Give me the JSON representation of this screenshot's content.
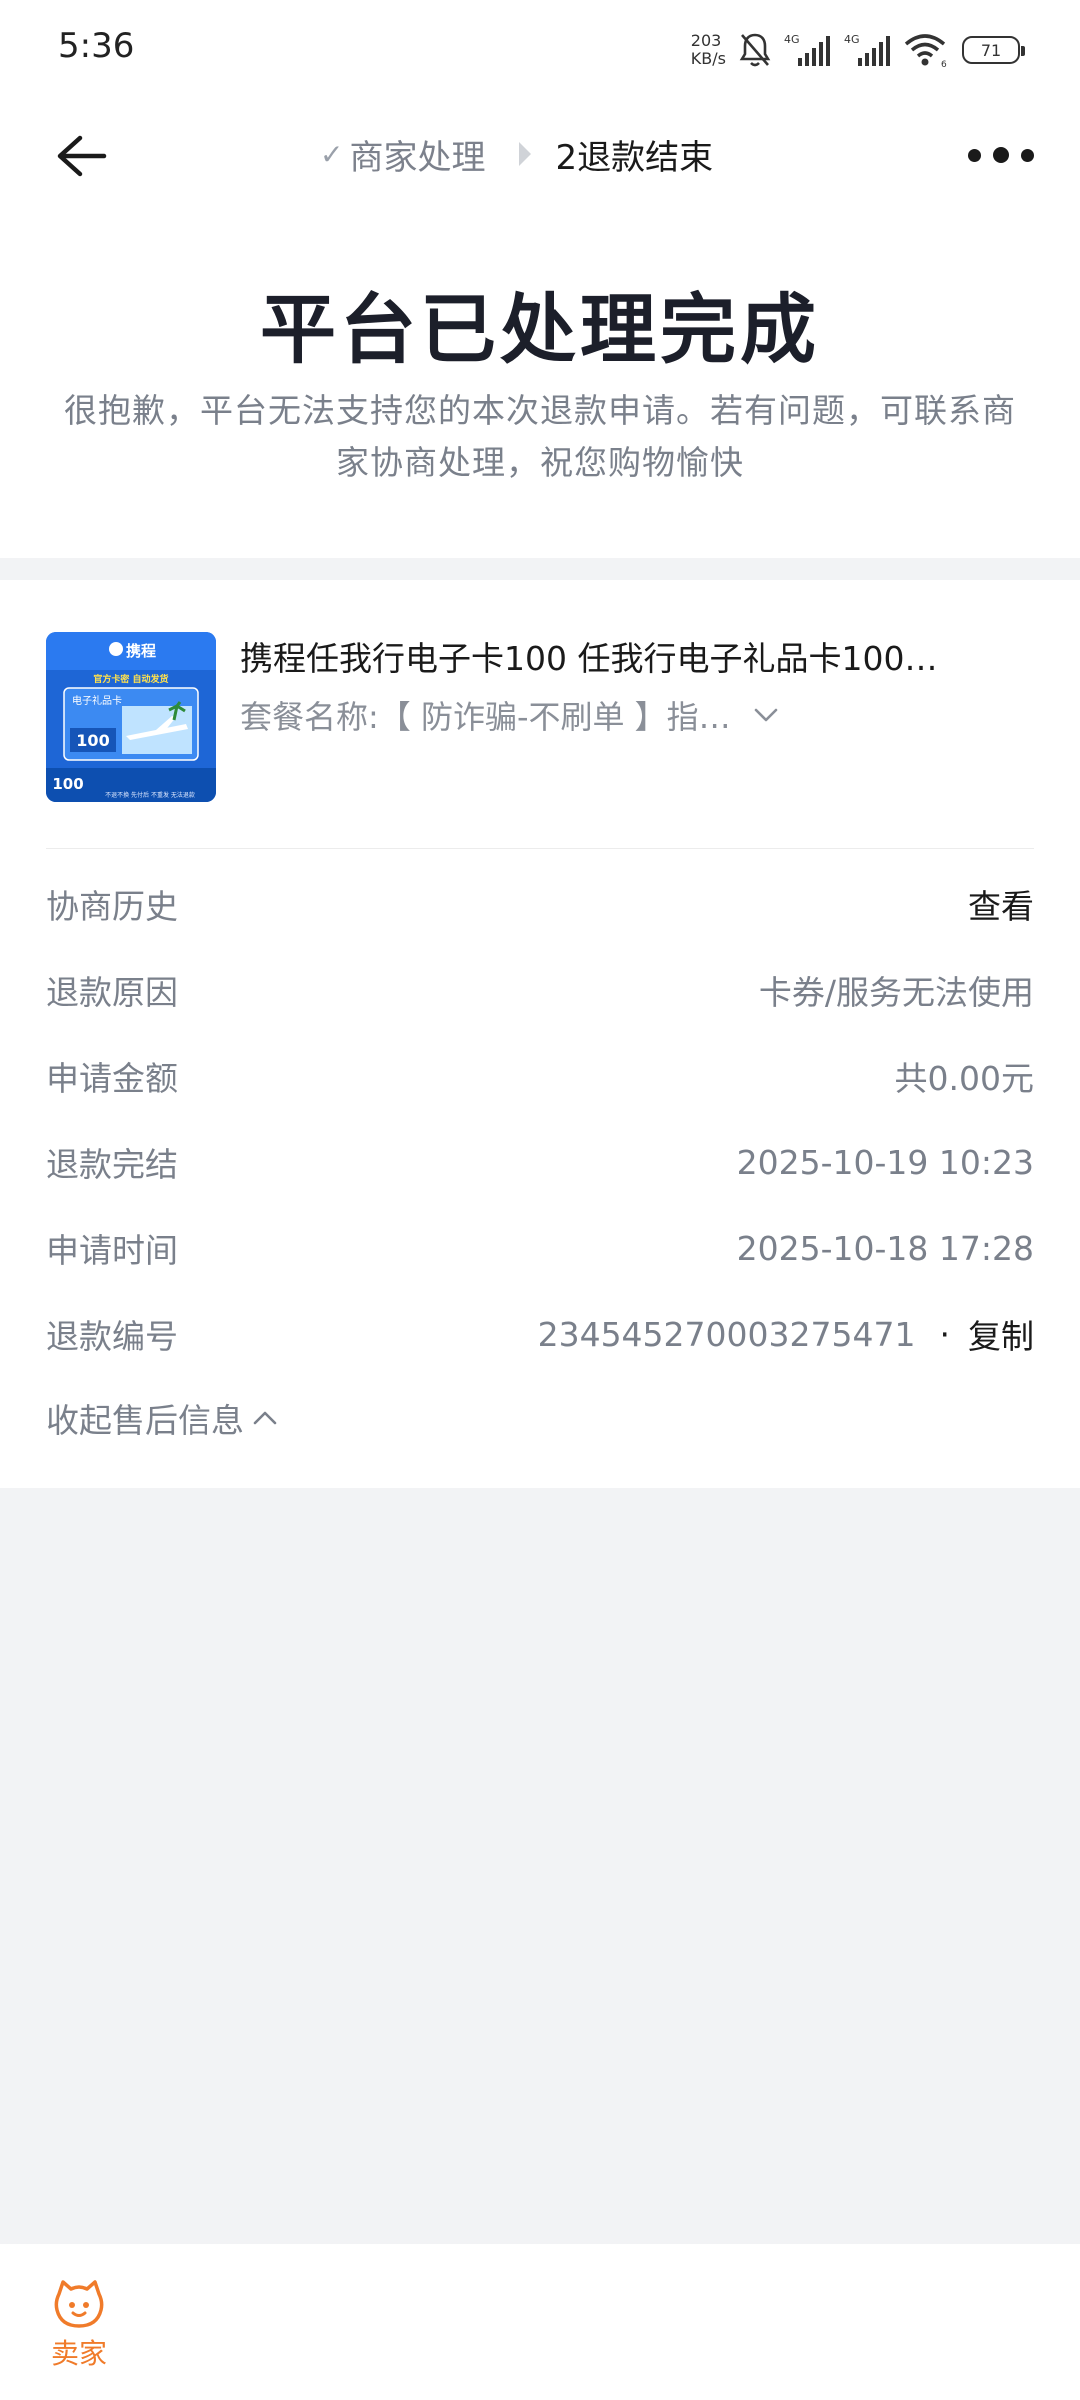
{
  "status_bar": {
    "time": "5:36",
    "net_speed_value": "203",
    "net_speed_unit": "KB/s",
    "network_1": "4G",
    "network_2": "4G",
    "wifi_badge": "6",
    "battery": "71"
  },
  "nav": {
    "step1_label": "商家处理",
    "step2_label": "2退款结束"
  },
  "hero": {
    "title": "平台已处理完成",
    "description": "很抱歉，平台无法支持您的本次退款申请。若有问题，可联系商家协商处理，祝您购物愉快"
  },
  "product": {
    "title": "携程任我行电子卡100 任我行电子礼品卡100…",
    "spec": "套餐名称:【 防诈骗-不刷单 】指…",
    "image": {
      "brand": "携程",
      "ribbon": "官方卡密 自动发货",
      "card_name": "电子礼品卡",
      "value": "100",
      "value_tag": "100",
      "footer": "不退不换 先付后 不重发 无法退款"
    }
  },
  "details": {
    "history_label": "协商历史",
    "history_action": "查看",
    "reason_label": "退款原因",
    "reason_value": "卡券/服务无法使用",
    "amount_label": "申请金额",
    "amount_value": "共0.00元",
    "complete_label": "退款完结",
    "complete_value": "2025-10-19 10:23",
    "apply_label": "申请时间",
    "apply_value": "2025-10-18 17:28",
    "number_label": "退款编号",
    "number_value": "234545270003275471",
    "copy_label": "复制",
    "collapse_label": "收起售后信息"
  },
  "bottom": {
    "seller_label": "卖家"
  },
  "colors": {
    "accent_orange": "#f07b2a",
    "text_primary": "#1a1a1a",
    "text_secondary": "#7a808b",
    "page_background": "#f2f3f5"
  }
}
